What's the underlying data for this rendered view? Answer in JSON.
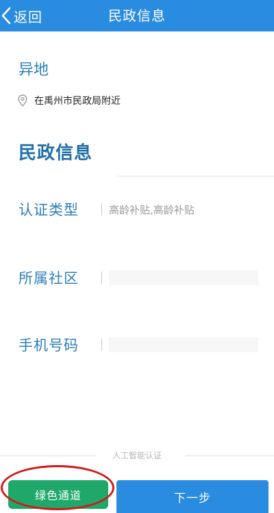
{
  "navbar": {
    "back_label": "返回",
    "title": "民政信息",
    "color": "#2a8ce0"
  },
  "location": {
    "title": "异地",
    "icon": "location-pin-icon",
    "text": "在禹州市民政局附近"
  },
  "section": {
    "title": "民政信息"
  },
  "form": {
    "fields": [
      {
        "label": "认证类型",
        "value": "高龄补贴,高龄补贴"
      },
      {
        "label": "所属社区",
        "value": ""
      },
      {
        "label": "手机号码",
        "value": ""
      }
    ]
  },
  "footer": {
    "ai_label": "人工智能认证",
    "green_button": "绿色通道",
    "next_button": "下一步",
    "green_color": "#1fa86a",
    "highlight_color": "#d01a1a"
  }
}
